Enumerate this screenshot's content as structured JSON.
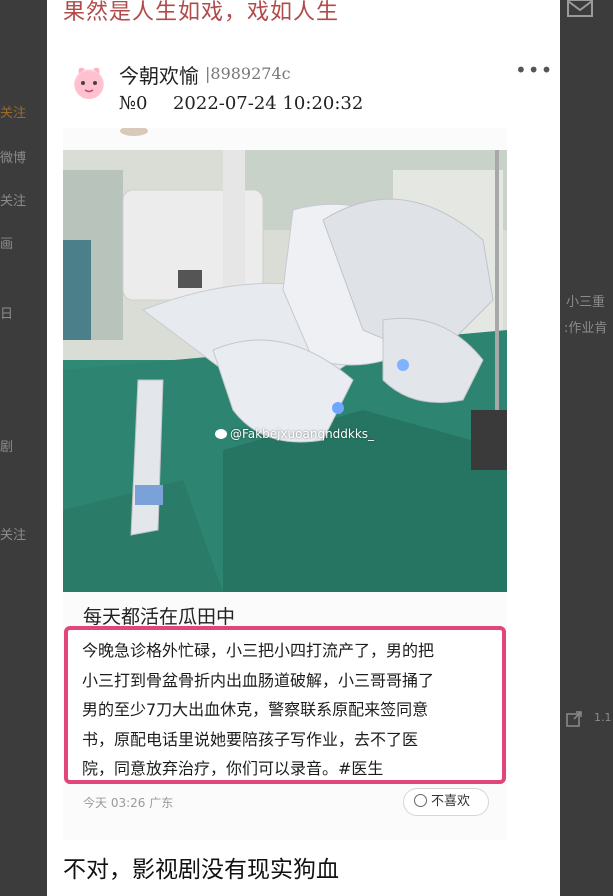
{
  "background": {
    "left_items": [
      "关注",
      "微博",
      "关注",
      "画",
      "日",
      "剧",
      "关注"
    ],
    "right_items": [
      "小三重",
      ":作业肯",
      "1.1"
    ]
  },
  "post": {
    "top_title": "果然是人生如戏，戏如人生",
    "author": "今朝欢愉",
    "author_id": "|8989274c",
    "floor": "№0",
    "datetime": "2022-07-24 10:20:32",
    "more_label": "•••"
  },
  "embedded": {
    "watermark": "@Fakbejxuoanqnddkks_",
    "heading": "每天都活在瓜田中",
    "quote_lines": [
      "今晚急诊格外忙碌，小三把小四打流产了，男的把",
      "小三打到骨盆骨折内出血肠道破解，小三哥哥捅了",
      "男的至少7刀大出血休克，警察联系原配来签同意",
      "书，原配电话里说她要陪孩子写作业，去不了医",
      "院，同意放弃治疗，你们可以录音。#医生"
    ],
    "time_location": "今天 03:26 广东",
    "dislike_label": "不喜欢"
  },
  "comment": "不对，影视剧没有现实狗血",
  "colors": {
    "title": "#b24a4a",
    "quote_border": "#e0457b",
    "drape_green": "#2f8a73"
  },
  "icons": [
    "mail-icon",
    "more-icon",
    "weibo-icon",
    "dislike-icon",
    "share-icon"
  ]
}
